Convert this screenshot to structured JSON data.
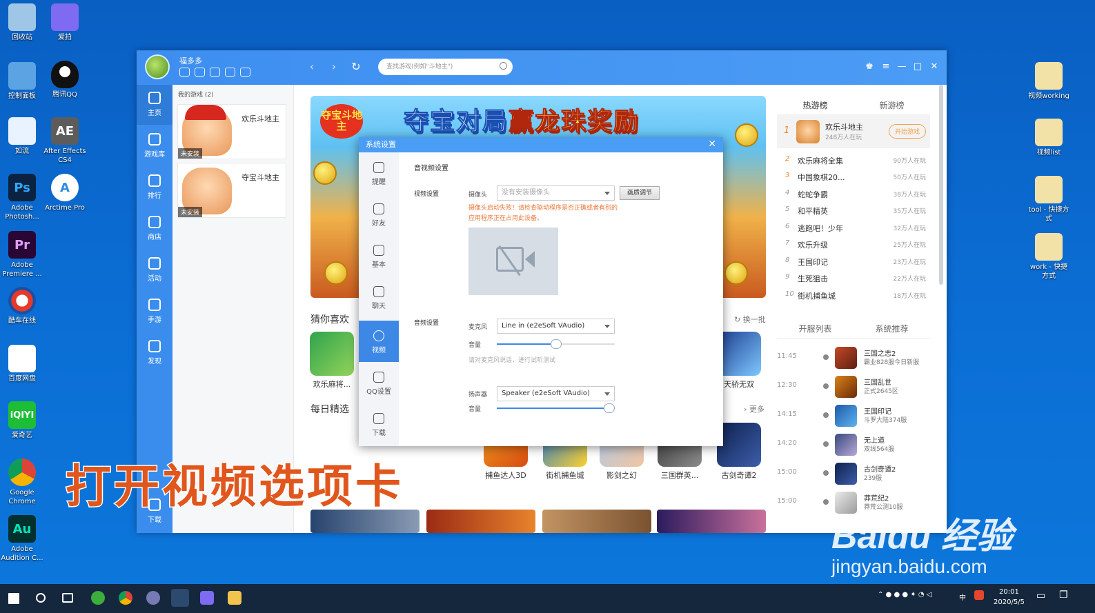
{
  "desktop": {
    "left_icons": [
      "回收站",
      "控制面板",
      "如流",
      "Adobe Photosh...",
      "Adobe Premiere ...",
      "酷车在线",
      "百度网盘",
      "爱奇艺",
      "Google Chrome",
      "Adobe Audition C..."
    ],
    "col2_icons": [
      "爱拍",
      "腾讯QQ",
      "After Effects CS4",
      "Arctime Pro"
    ],
    "right_icons": [
      "视频working",
      "视频list",
      "tool - 快捷方式",
      "work - 快捷方式"
    ]
  },
  "window": {
    "username": "福多多",
    "search_placeholder": "查找游戏(例如\"斗地主\")",
    "sidebar": [
      "主页",
      "游戏库",
      "排行",
      "商店",
      "活动",
      "手游",
      "发现",
      "下载"
    ],
    "my_games_header": "我的游戏 (2)",
    "my_games": [
      {
        "name": "欢乐斗地主",
        "tag": "未安装"
      },
      {
        "name": "夺宝斗地主",
        "tag": "未安装"
      }
    ],
    "banner": {
      "logo": "夺宝斗地主",
      "title_a": "夺宝对局",
      "title_b": "赢龙珠奖励"
    },
    "guess_title": "猜你喜欢",
    "refresh_label": "换一批",
    "guess_games": [
      "欢乐麻将...",
      "天骄无双"
    ],
    "daily_title": "每日精选",
    "more_label": "更多",
    "daily_games": [
      "捕鱼达人3D",
      "街机捕鱼城",
      "影剑之幻",
      "三国群英...",
      "古剑奇谭2"
    ],
    "rank": {
      "tabs": [
        "热游榜",
        "新游榜"
      ],
      "top1": {
        "name": "欢乐斗地主",
        "players": "248万人在玩",
        "play_label": "开始游戏"
      },
      "rows": [
        {
          "n": "2",
          "name": "欢乐麻将全集",
          "players": "90万人在玩"
        },
        {
          "n": "3",
          "name": "中国象棋20...",
          "players": "50万人在玩"
        },
        {
          "n": "4",
          "name": "蛇蛇争霸",
          "players": "38万人在玩"
        },
        {
          "n": "5",
          "name": "和平精英",
          "players": "35万人在玩"
        },
        {
          "n": "6",
          "name": "逃跑吧！少年",
          "players": "32万人在玩"
        },
        {
          "n": "7",
          "name": "欢乐升级",
          "players": "25万人在玩"
        },
        {
          "n": "8",
          "name": "王国印记",
          "players": "23万人在玩"
        },
        {
          "n": "9",
          "name": "生死狙击",
          "players": "22万人在玩"
        },
        {
          "n": "10",
          "name": "街机捕鱼城",
          "players": "18万人在玩"
        }
      ],
      "tabs2": [
        "开服列表",
        "系统推荐"
      ],
      "servers": [
        {
          "time": "11:45",
          "l1": "三国之志2",
          "l2": "霸业828服今日新服"
        },
        {
          "time": "12:30",
          "l1": "三国乱世",
          "l2": "正式2645区"
        },
        {
          "time": "14:15",
          "l1": "王国印记",
          "l2": "斗罗大陆374服"
        },
        {
          "time": "14:20",
          "l1": "无上道",
          "l2": "双线564服"
        },
        {
          "time": "15:00",
          "l1": "古剑奇谭2",
          "l2": "239服"
        },
        {
          "time": "15:00",
          "l1": "莽荒纪2",
          "l2": "莽荒公测10服"
        }
      ]
    }
  },
  "dialog": {
    "title": "系统设置",
    "tabs": [
      "提醒",
      "好友",
      "基本",
      "聊天",
      "视频",
      "QQ设置",
      "下载"
    ],
    "active_tab": "视频",
    "section_title": "音视频设置",
    "video_settings": "视频设置",
    "camera_label": "摄像头",
    "camera_value": "没有安装摄像头",
    "quality_button": "画质调节",
    "camera_error": "摄像头启动失败！请检查驱动程序是否正确或者有别的应用程序正在占用此设备。",
    "audio_settings": "音频设置",
    "mic_label": "麦克风",
    "mic_value": "Line in (e2eSoft VAudio)",
    "volume_label": "音量",
    "mic_volume": 0.5,
    "mic_hint": "请对麦克风说话，进行试听测试",
    "speaker_label": "扬声器",
    "speaker_value": "Speaker (e2eSoft VAudio)",
    "speaker_volume": 1.0
  },
  "overlay": {
    "caption": "打开视频选项卡"
  },
  "watermark": {
    "line1": "Baidu 经验",
    "line2": "jingyan.baidu.com"
  },
  "taskbar": {
    "time": "20:01",
    "date": "2020/5/5",
    "ime": "中"
  }
}
